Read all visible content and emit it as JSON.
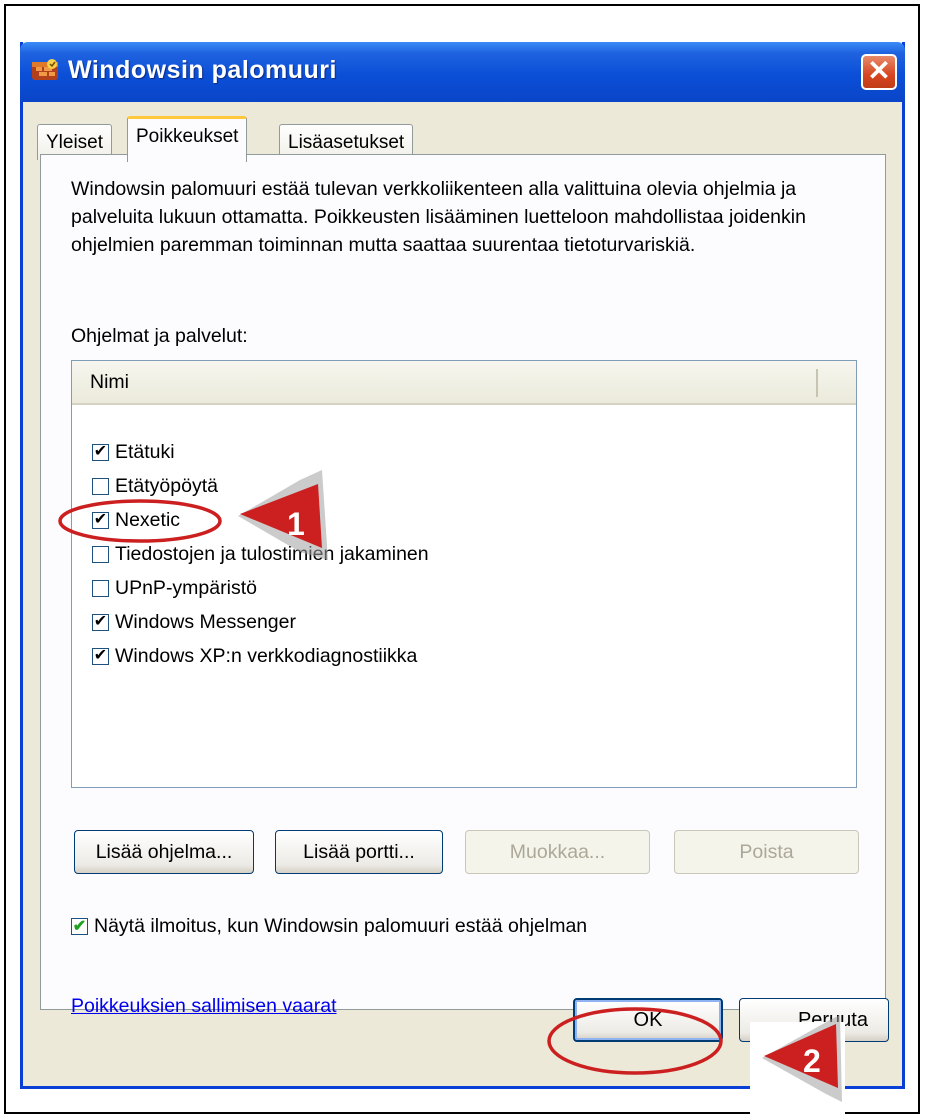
{
  "window": {
    "title": "Windowsin palomuuri",
    "close_label": "✕"
  },
  "tabs": [
    {
      "label": "Yleiset",
      "active": false
    },
    {
      "label": "Poikkeukset",
      "active": true
    },
    {
      "label": "Lisäasetukset",
      "active": false
    }
  ],
  "panel": {
    "description": "Windowsin palomuuri estää tulevan verkkoliikenteen alla valittuina olevia ohjelmia ja palveluita lukuun ottamatta. Poikkeusten lisääminen luetteloon mahdollistaa joidenkin ohjelmien paremman toiminnan mutta saattaa suurentaa tietoturvariskiä.",
    "list_label": "Ohjelmat ja palvelut:",
    "column_header": "Nimi",
    "items": [
      {
        "label": "Etätuki",
        "checked": true
      },
      {
        "label": "Etätyöpöytä",
        "checked": false
      },
      {
        "label": "Nexetic",
        "checked": true
      },
      {
        "label": "Tiedostojen ja tulostimien jakaminen",
        "checked": false
      },
      {
        "label": "UPnP-ympäristö",
        "checked": false
      },
      {
        "label": "Windows Messenger",
        "checked": true
      },
      {
        "label": "Windows XP:n verkkodiagnostiikka",
        "checked": true
      }
    ],
    "buttons": {
      "add_program": "Lisää ohjelma...",
      "add_port": "Lisää portti...",
      "edit": "Muokkaa...",
      "delete": "Poista"
    },
    "notify_label": "Näytä ilmoitus, kun Windowsin palomuuri estää ohjelman",
    "notify_checked": true,
    "link": "Poikkeuksien sallimisen vaarat"
  },
  "footer": {
    "ok": "OK",
    "cancel": "Peruuta"
  },
  "annotations": {
    "marker_1": "1",
    "marker_2": "2",
    "highlight_color": "#cc1f1f"
  }
}
